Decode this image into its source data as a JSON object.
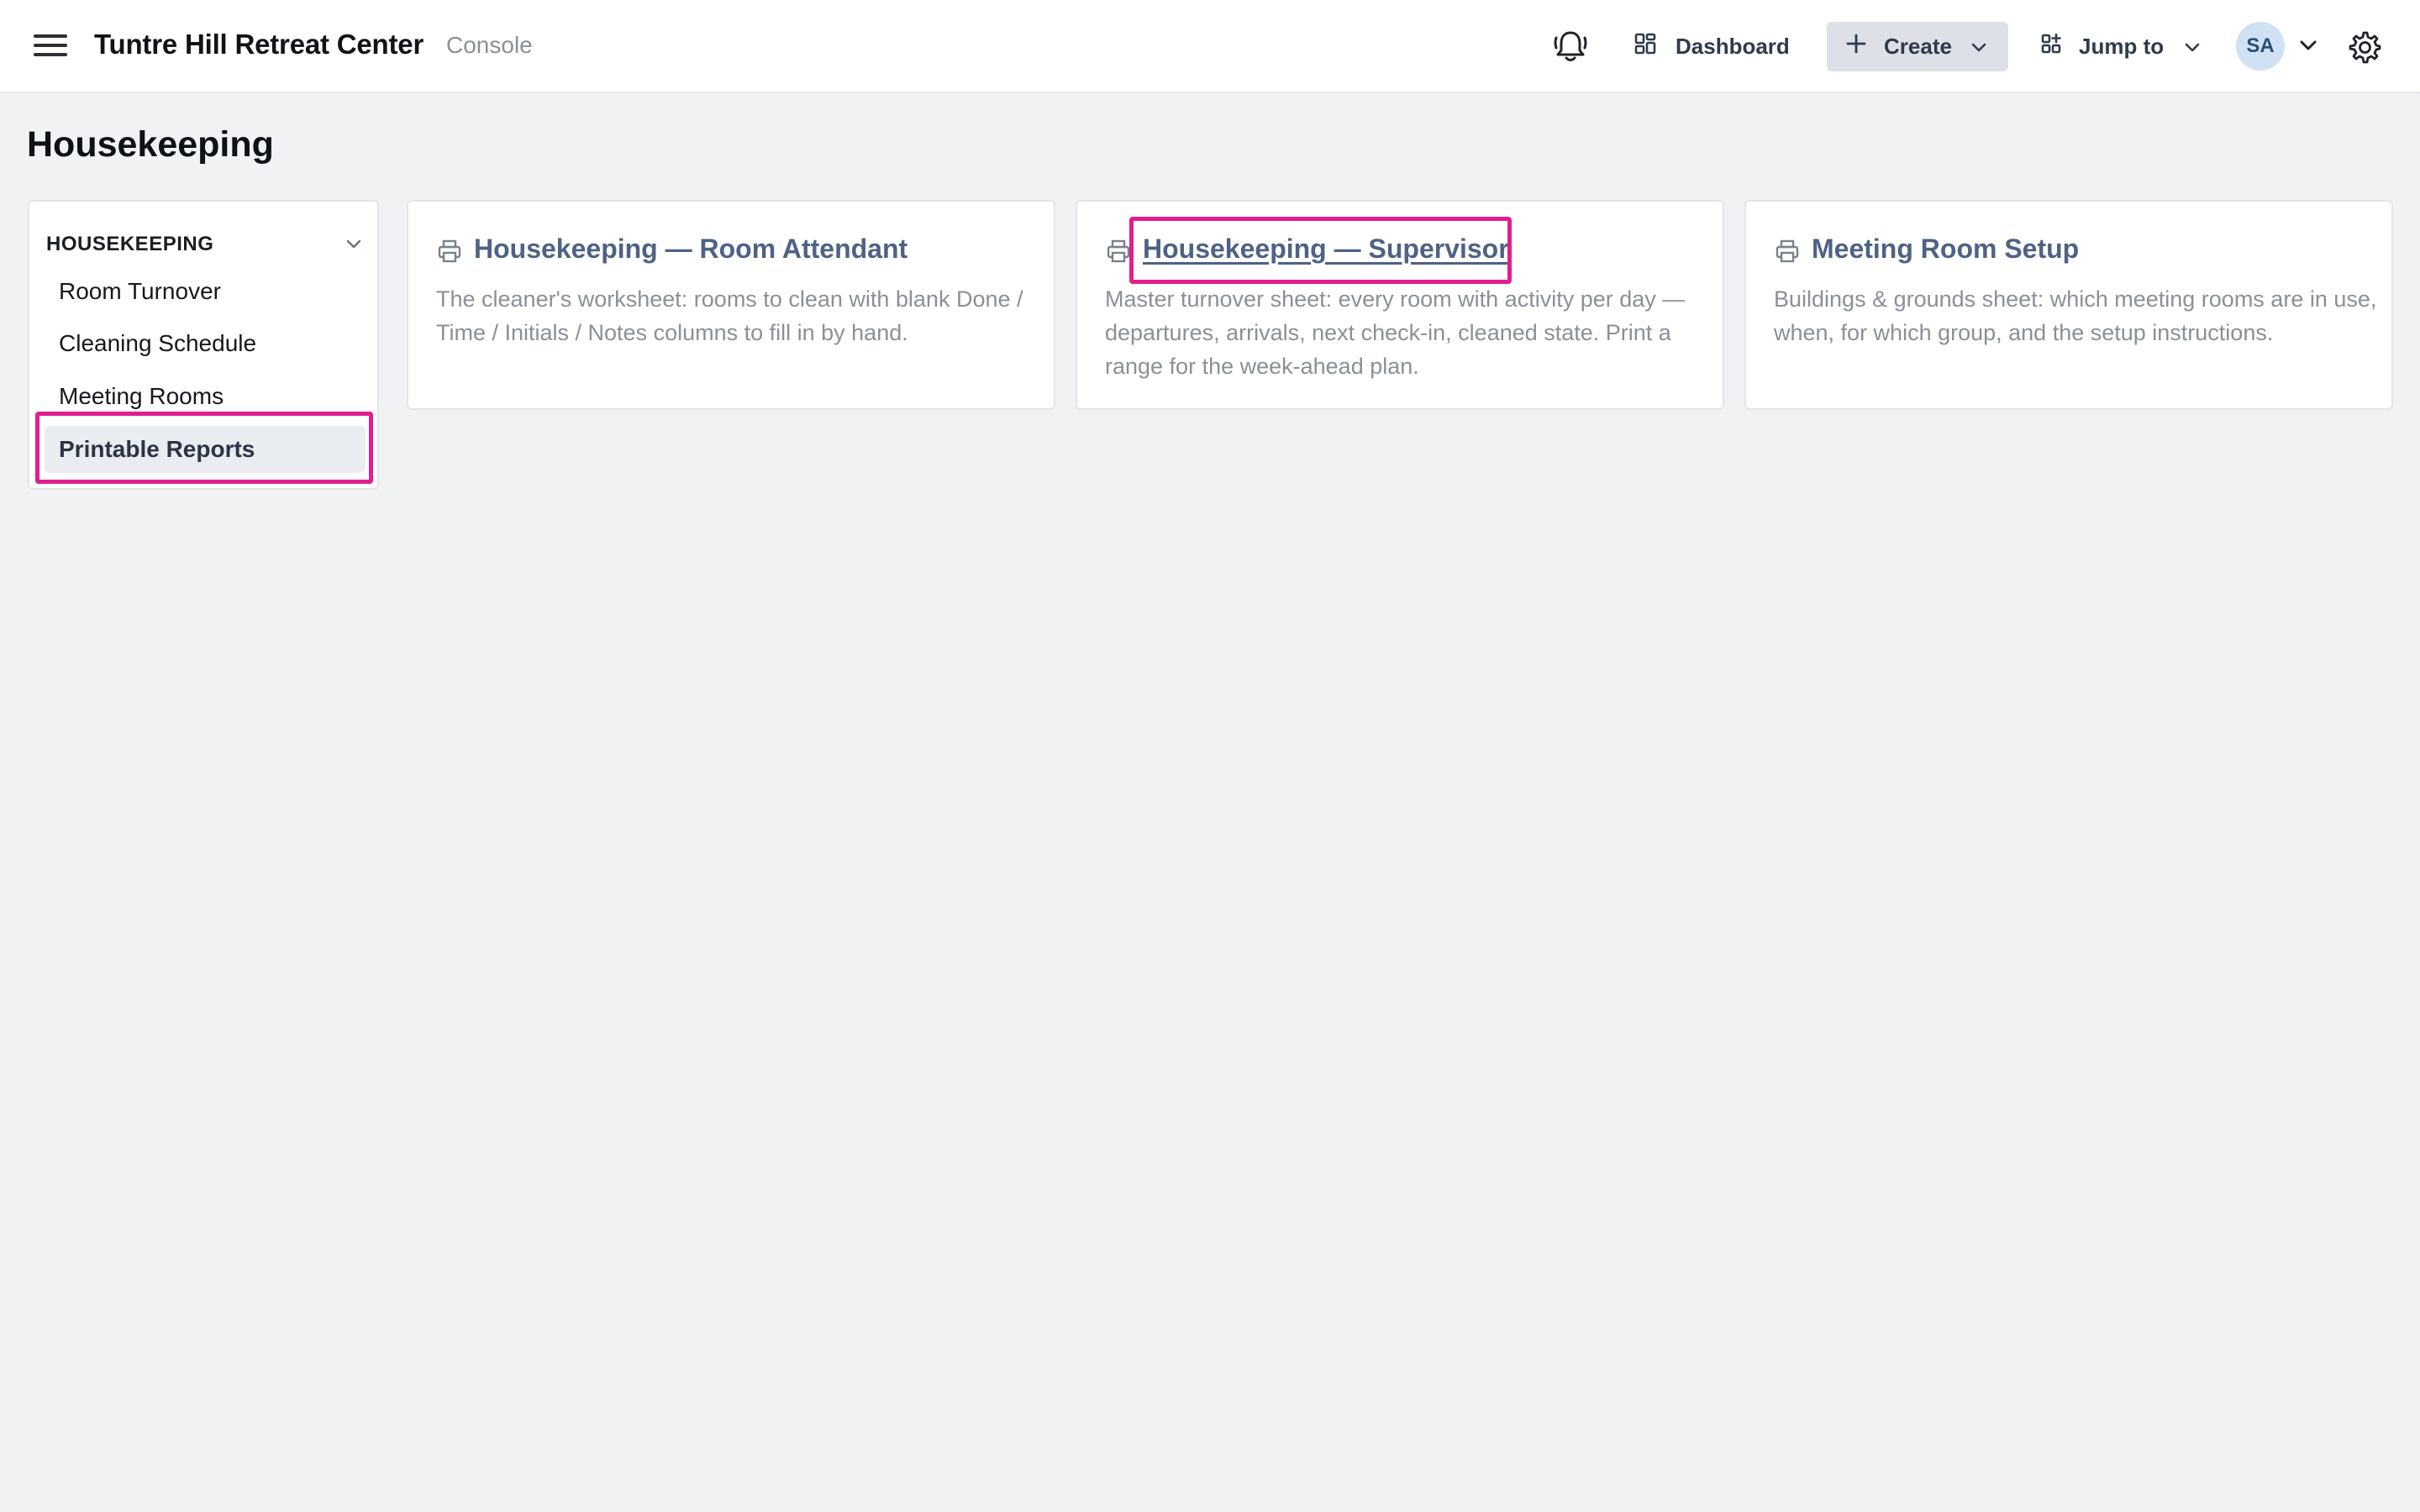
{
  "header": {
    "brand": "Tuntre Hill Retreat Center",
    "brand_sub": "Console",
    "dashboard_label": "Dashboard",
    "create_label": "Create",
    "jump_label": "Jump to",
    "avatar_initials": "SA"
  },
  "page": {
    "title": "Housekeeping"
  },
  "sidebar": {
    "section_label": "HOUSEKEEPING",
    "items": [
      {
        "label": "Room Turnover"
      },
      {
        "label": "Cleaning Schedule"
      },
      {
        "label": "Meeting Rooms"
      },
      {
        "label": "Printable Reports",
        "active": true
      }
    ]
  },
  "cards": [
    {
      "title": "Housekeeping — Room Attendant",
      "description": "The cleaner's worksheet: rooms to clean with blank Done / Time / Initials / Notes columns to fill in by hand."
    },
    {
      "title": "Housekeeping — Supervisor",
      "description": "Master turnover sheet: every room with activity per day — departures, arrivals, next check-in, cleaned state. Print a range for the week-ahead plan."
    },
    {
      "title": "Meeting Room Setup",
      "description": "Buildings & grounds sheet: which meeting rooms are in use, when, for which group, and the setup instructions."
    }
  ],
  "colors": {
    "accent_highlight": "#e11e8f",
    "link_title": "#4e6284",
    "background": "#f1f2f4"
  },
  "icons": [
    "menu-icon",
    "bell-icon",
    "dashboard-grid-icon",
    "plus-icon",
    "chevron-down-icon",
    "apps-icon",
    "gear-icon",
    "printer-icon"
  ]
}
